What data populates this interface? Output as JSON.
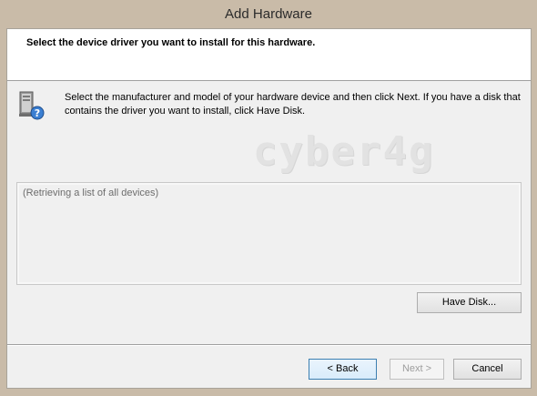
{
  "window": {
    "title": "Add Hardware"
  },
  "header": {
    "title": "Select the device driver you want to install for this hardware."
  },
  "instruction": {
    "text": "Select the manufacturer and model of your hardware device and then click Next. If you have a disk that contains the driver you want to install, click Have Disk."
  },
  "watermark": {
    "text": "cyber4g"
  },
  "device_list": {
    "status": "(Retrieving a list of all devices)"
  },
  "buttons": {
    "have_disk": "Have Disk...",
    "back": "< Back",
    "next": "Next >",
    "cancel": "Cancel"
  },
  "colors": {
    "titlebar": "#c9bba8",
    "client": "#f0f0f0",
    "header": "#ffffff",
    "disabled_text": "#9d9d9d",
    "focus_border": "#3c7fb1"
  },
  "icons": {
    "device": "hardware-question-icon"
  }
}
